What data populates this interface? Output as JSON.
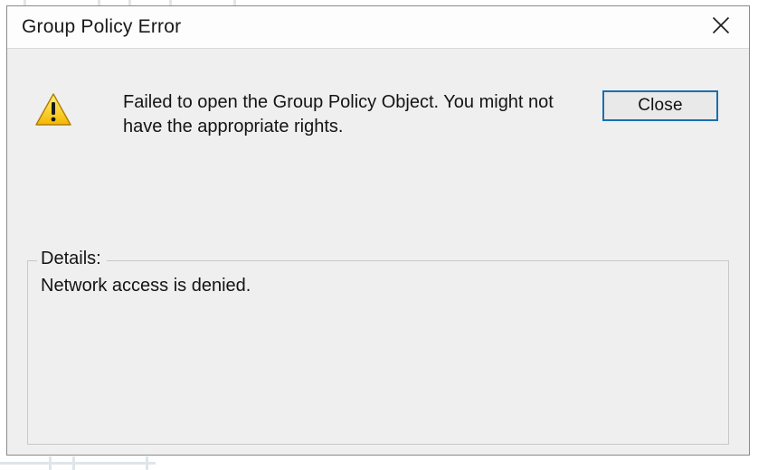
{
  "dialog": {
    "title": "Group Policy Error",
    "message": "Failed to open the Group Policy Object.  You might not have the appropriate rights.",
    "close_button_label": "Close",
    "details_label": "Details:",
    "details_text": "Network access is denied.",
    "icon_name": "warning-icon"
  }
}
